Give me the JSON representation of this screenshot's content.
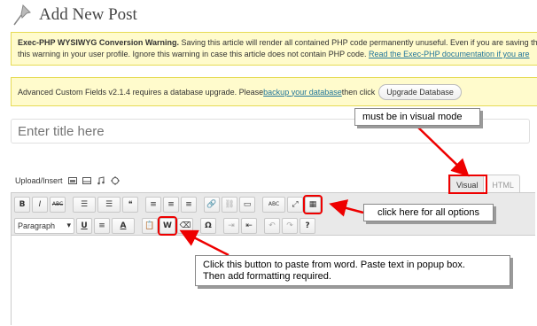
{
  "header": {
    "title": "Add New Post",
    "icon": "pushpin-icon"
  },
  "notices": {
    "warning_bold": "Exec-PHP WYSIWYG Conversion Warning.",
    "warning_text": " Saving this article will render all contained PHP code permanently unuseful. Even if you are saving th",
    "warning_line2": "this warning in your user profile. Ignore this warning in case this article does not contain PHP code. ",
    "warning_link": "Read the Exec-PHP documentation if you are",
    "acf_text": "Advanced Custom Fields v2.1.4 requires a database upgrade. Please ",
    "acf_link": "backup your database",
    "acf_text2": " then click ",
    "acf_button": "Upgrade Database"
  },
  "title_field": {
    "placeholder": "Enter title here",
    "value": ""
  },
  "editor": {
    "upload_label": "Upload/Insert",
    "tabs": [
      {
        "label": "Visual",
        "active": true
      },
      {
        "label": "HTML",
        "active": false
      }
    ],
    "format_select": "Paragraph",
    "row1_buttons": [
      "B",
      "I",
      "ABC",
      "☰",
      "☰",
      "❝",
      "≡",
      "≡",
      "≡",
      "🔗",
      "⛓",
      "▭",
      "ABC",
      "⤢",
      "▦"
    ],
    "row2_buttons": [
      "U",
      "≡",
      "A",
      "📋",
      "W",
      "⌫",
      "Ω",
      "⇥",
      "⇤",
      "↶",
      "↷",
      "?"
    ]
  },
  "callouts": {
    "visual_mode": "must be in visual mode",
    "all_options": "click here for all options",
    "paste_word_line1": "Click this button to paste from word.  Paste text in popup box.",
    "paste_word_line2": "Then add formatting required."
  },
  "colors": {
    "notice_bg": "#fffbcc",
    "notice_border": "#e6db55",
    "link": "#21759b",
    "highlight": "#ee0000"
  }
}
